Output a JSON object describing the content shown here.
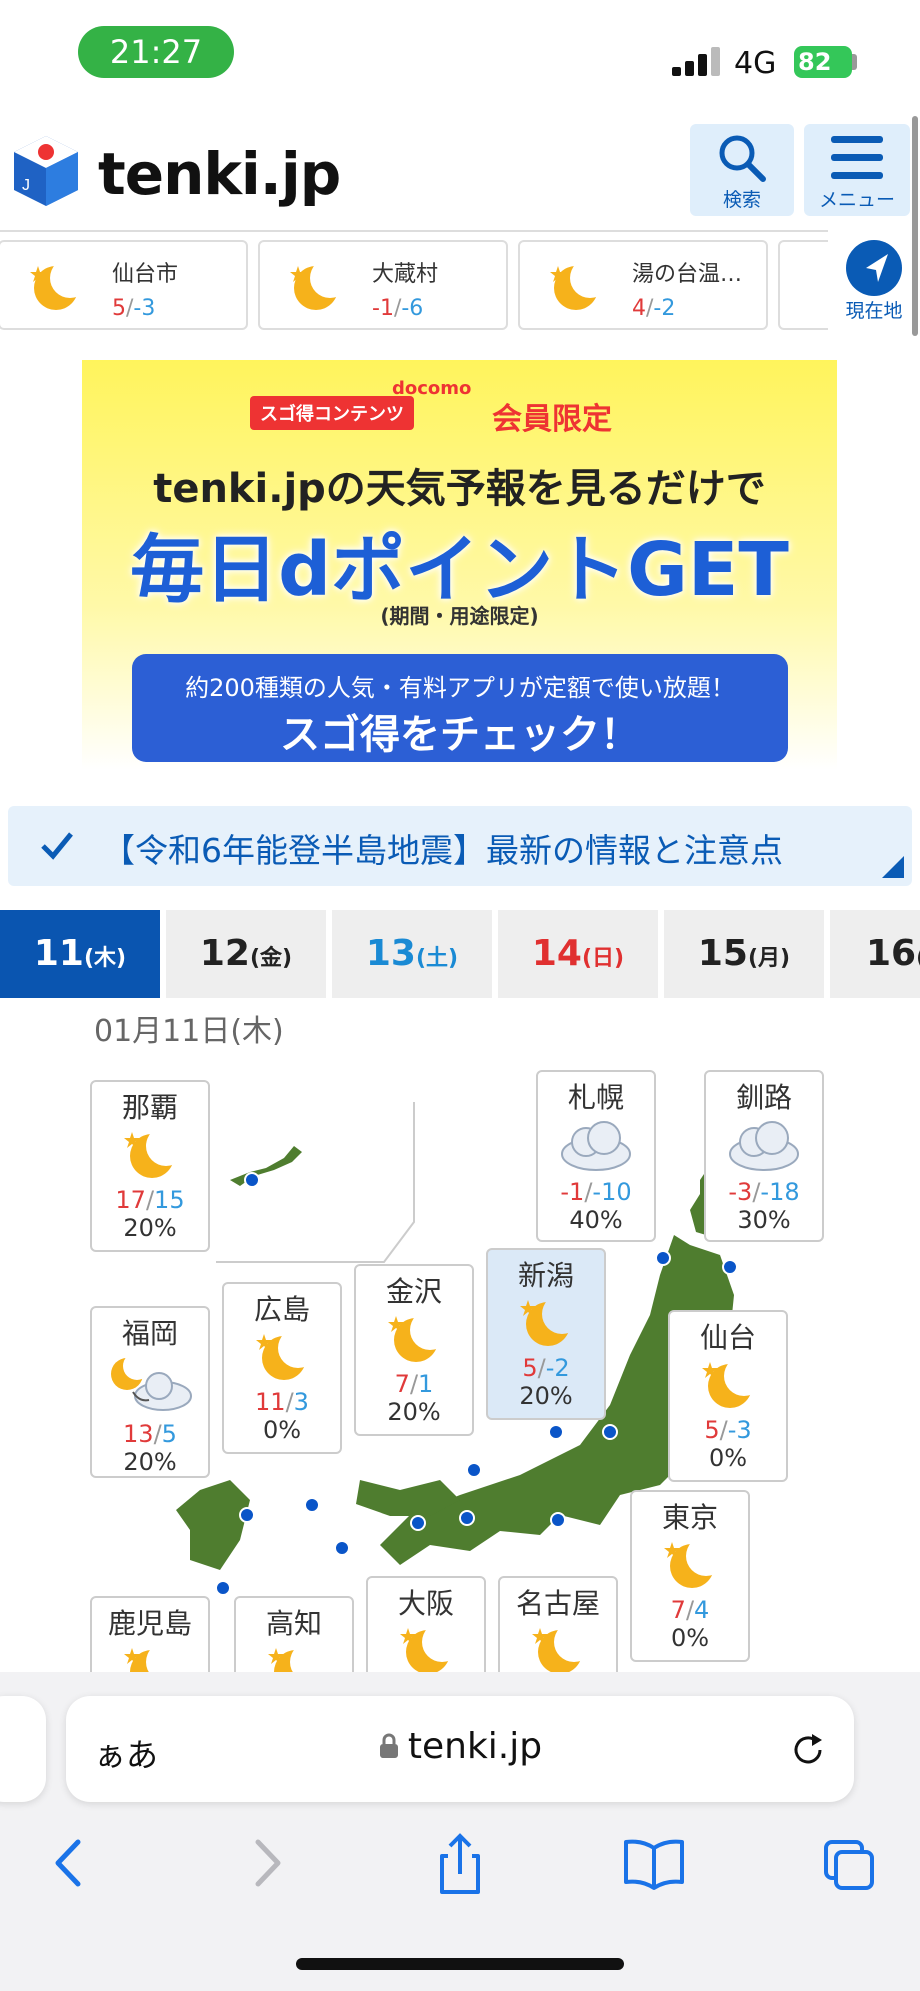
{
  "status_bar": {
    "time": "21:27",
    "network": "4G",
    "battery": "82"
  },
  "header": {
    "logo": "tenki.jp",
    "search_label": "検索",
    "menu_label": "メニュー"
  },
  "quick_cities": [
    {
      "name": "仙台市",
      "high": "5",
      "low": "-3"
    },
    {
      "name": "大蔵村",
      "high": "-1",
      "low": "-6"
    },
    {
      "name": "湯の台温…",
      "high": "4",
      "low": "-2"
    }
  ],
  "current_location_label": "現在地",
  "banner": {
    "docomo": "docomo",
    "tag": "スゴ得コンテンツ",
    "members_only": "会員限定",
    "line1": "tenki.jpの天気予報を見るだけで",
    "line2": "毎日dポイントGET",
    "line3": "(期間・用途限定)",
    "button_sub": "約200種類の人気・有料アプリが定額で使い放題！",
    "button_main": "スゴ得をチェック！"
  },
  "alert": {
    "text": "【令和6年能登半島地震】最新の情報と注意点"
  },
  "day_tabs": [
    {
      "num": "11",
      "dow": "(木)"
    },
    {
      "num": "12",
      "dow": "(金)"
    },
    {
      "num": "13",
      "dow": "(土)"
    },
    {
      "num": "14",
      "dow": "(日)"
    },
    {
      "num": "15",
      "dow": "(月)"
    },
    {
      "num": "16",
      "dow": "("
    }
  ],
  "date_label": "01月11日(木)",
  "map_cities": [
    {
      "name": "那覇",
      "high": "17",
      "low": "15",
      "pop": "20%",
      "weather": "moon-icon"
    },
    {
      "name": "札幌",
      "high": "-1",
      "low": "-10",
      "pop": "40%",
      "weather": "cloud-icon"
    },
    {
      "name": "釧路",
      "high": "-3",
      "low": "-18",
      "pop": "30%",
      "weather": "cloud-icon"
    },
    {
      "name": "福岡",
      "high": "13",
      "low": "5",
      "pop": "20%",
      "weather": "moon-cloud-icon"
    },
    {
      "name": "広島",
      "high": "11",
      "low": "3",
      "pop": "0%",
      "weather": "moon-icon"
    },
    {
      "name": "金沢",
      "high": "7",
      "low": "1",
      "pop": "20%",
      "weather": "moon-icon"
    },
    {
      "name": "新潟",
      "high": "5",
      "low": "-2",
      "pop": "20%",
      "weather": "moon-icon"
    },
    {
      "name": "仙台",
      "high": "5",
      "low": "-3",
      "pop": "0%",
      "weather": "moon-icon"
    },
    {
      "name": "東京",
      "high": "7",
      "low": "4",
      "pop": "0%",
      "weather": "moon-icon"
    },
    {
      "name": "鹿児島",
      "weather": "moon-icon"
    },
    {
      "name": "高知",
      "weather": "moon-icon"
    },
    {
      "name": "大阪",
      "weather": "moon-icon"
    },
    {
      "name": "名古屋",
      "weather": "moon-icon"
    }
  ],
  "safari": {
    "aa": "ぁあ",
    "host": "tenki.jp"
  },
  "colors": {
    "brand_blue": "#0a55b0",
    "high_red": "#e03a3a",
    "low_blue": "#3399dd",
    "status_green": "#34b246"
  }
}
